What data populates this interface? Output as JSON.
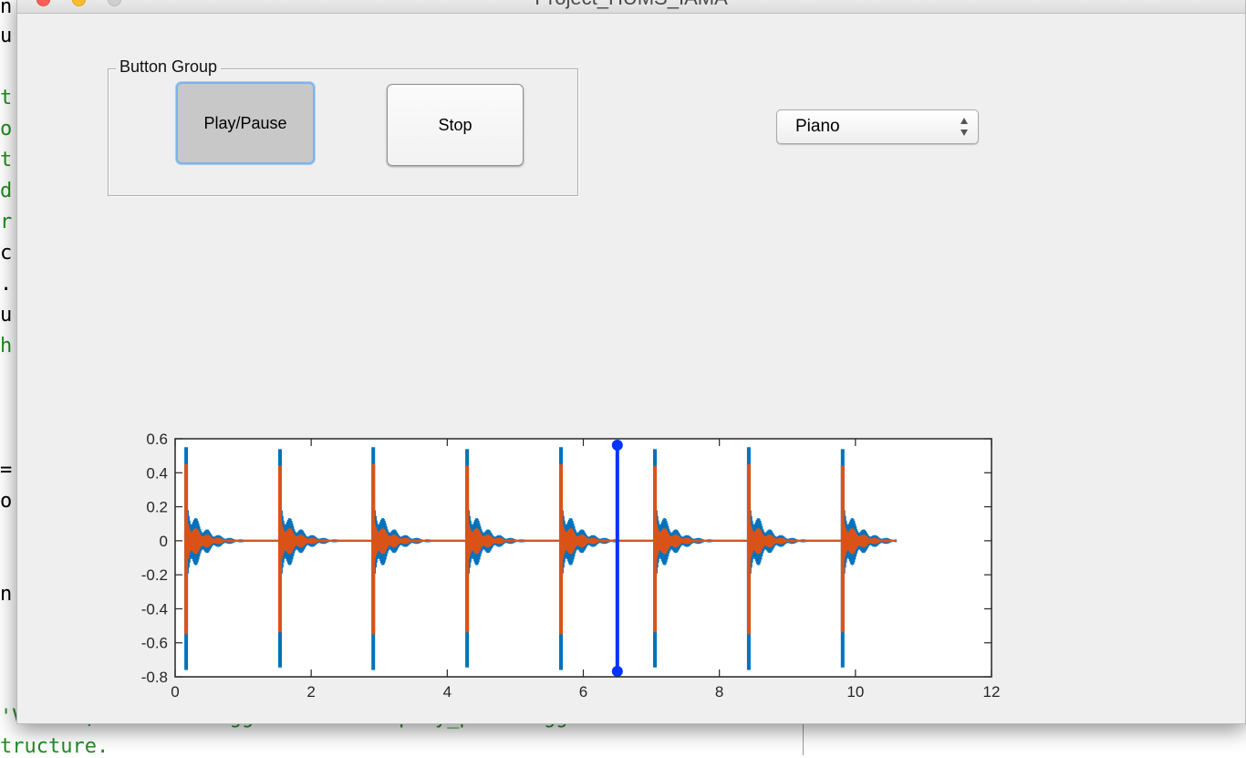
{
  "window": {
    "title": "Project_HUMS_IAMA"
  },
  "editor": {
    "left_chars": [
      "n",
      "u",
      "",
      "t",
      "o",
      "t",
      "d",
      "r",
      "c",
      ".",
      "u",
      "h",
      "",
      "",
      "",
      "=",
      "o",
      "",
      "",
      "n",
      ""
    ],
    "bottom_lines": [
      "'Value') returns toggle state of play_pausetogglebutton",
      "tructure."
    ]
  },
  "button_group": {
    "legend": "Button Group",
    "play_pause_label": "Play/Pause",
    "stop_label": "Stop"
  },
  "instrument_select": {
    "selected": "Piano"
  },
  "colors": {
    "series1": "#0072bd",
    "series2": "#d95319",
    "cursor": "#0033ff"
  },
  "chart_data": {
    "type": "line",
    "title": "",
    "xlabel": "",
    "ylabel": "",
    "xlim": [
      0,
      12
    ],
    "ylim": [
      -0.8,
      0.6
    ],
    "xticks": [
      0,
      2,
      4,
      6,
      8,
      10,
      12
    ],
    "yticks": [
      0.6,
      0.4,
      0.2,
      0,
      -0.2,
      -0.4,
      -0.6,
      -0.8
    ],
    "grid": false,
    "legend": "none",
    "onsets": [
      0.15,
      1.53,
      2.9,
      4.28,
      5.66,
      7.04,
      8.42,
      9.8
    ],
    "end_time": 10.6,
    "series": [
      {
        "channel": 1,
        "peak_max": 0.55,
        "peak_min": -0.76,
        "color": "#0072bd"
      },
      {
        "channel": 2,
        "peak_max": 0.45,
        "peak_min": -0.55,
        "color": "#d95319"
      }
    ],
    "cursor_x": 6.5
  }
}
